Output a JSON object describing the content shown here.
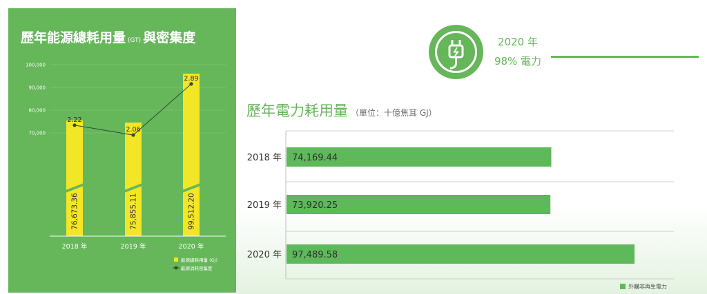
{
  "left_panel": {
    "title_main": "歷年能源總耗用量",
    "title_unit": "(GT)",
    "title_suffix": "與密集度"
  },
  "right_panel": {
    "badge_year": "2020 年",
    "badge_text": "98% 電力",
    "title": "歷年電力耗用量",
    "unit": "（單位：十億焦耳 GJ）"
  },
  "colors": {
    "panel_green": "#66b65a",
    "bar_yellow": "#f3e626",
    "bar_green": "#5db95a",
    "line_dark": "#2f4f2f",
    "grid": "#cfcfcf"
  },
  "icons": {
    "badge": "power-plug-icon"
  },
  "chart_data": [
    {
      "type": "bar",
      "title": "歷年能源總耗用量 (GT) 與密集度",
      "categories": [
        "2018 年",
        "2019 年",
        "2020 年"
      ],
      "series": [
        {
          "name": "能源總耗用量 (GJ)",
          "values": [
            76673.36,
            75855.11,
            99512.2
          ],
          "labels": [
            "76,673.36",
            "75,855.11",
            "99,512.20"
          ]
        },
        {
          "name": "能源消耗密集度",
          "type": "line",
          "values": [
            2.22,
            2.06,
            2.89
          ],
          "labels": [
            "2.22",
            "2.06",
            "2.89"
          ]
        }
      ],
      "y_ticks": [
        "100,000",
        "90,000",
        "80,000",
        "70,000"
      ],
      "ylim": [
        70000,
        100000
      ],
      "axis_break": true
    },
    {
      "type": "bar",
      "orientation": "horizontal",
      "title": "歷年電力耗用量",
      "unit": "（單位：十億焦耳 GJ）",
      "categories": [
        "2018 年",
        "2019 年",
        "2020 年"
      ],
      "series": [
        {
          "name": "外購非再生電力",
          "values": [
            74169.44,
            73920.25,
            97489.58
          ],
          "labels": [
            "74,169.44",
            "73,920.25",
            "97,489.58"
          ]
        }
      ],
      "xlim": [
        0,
        108500
      ],
      "grid": true,
      "legend": "bottom-right"
    }
  ]
}
